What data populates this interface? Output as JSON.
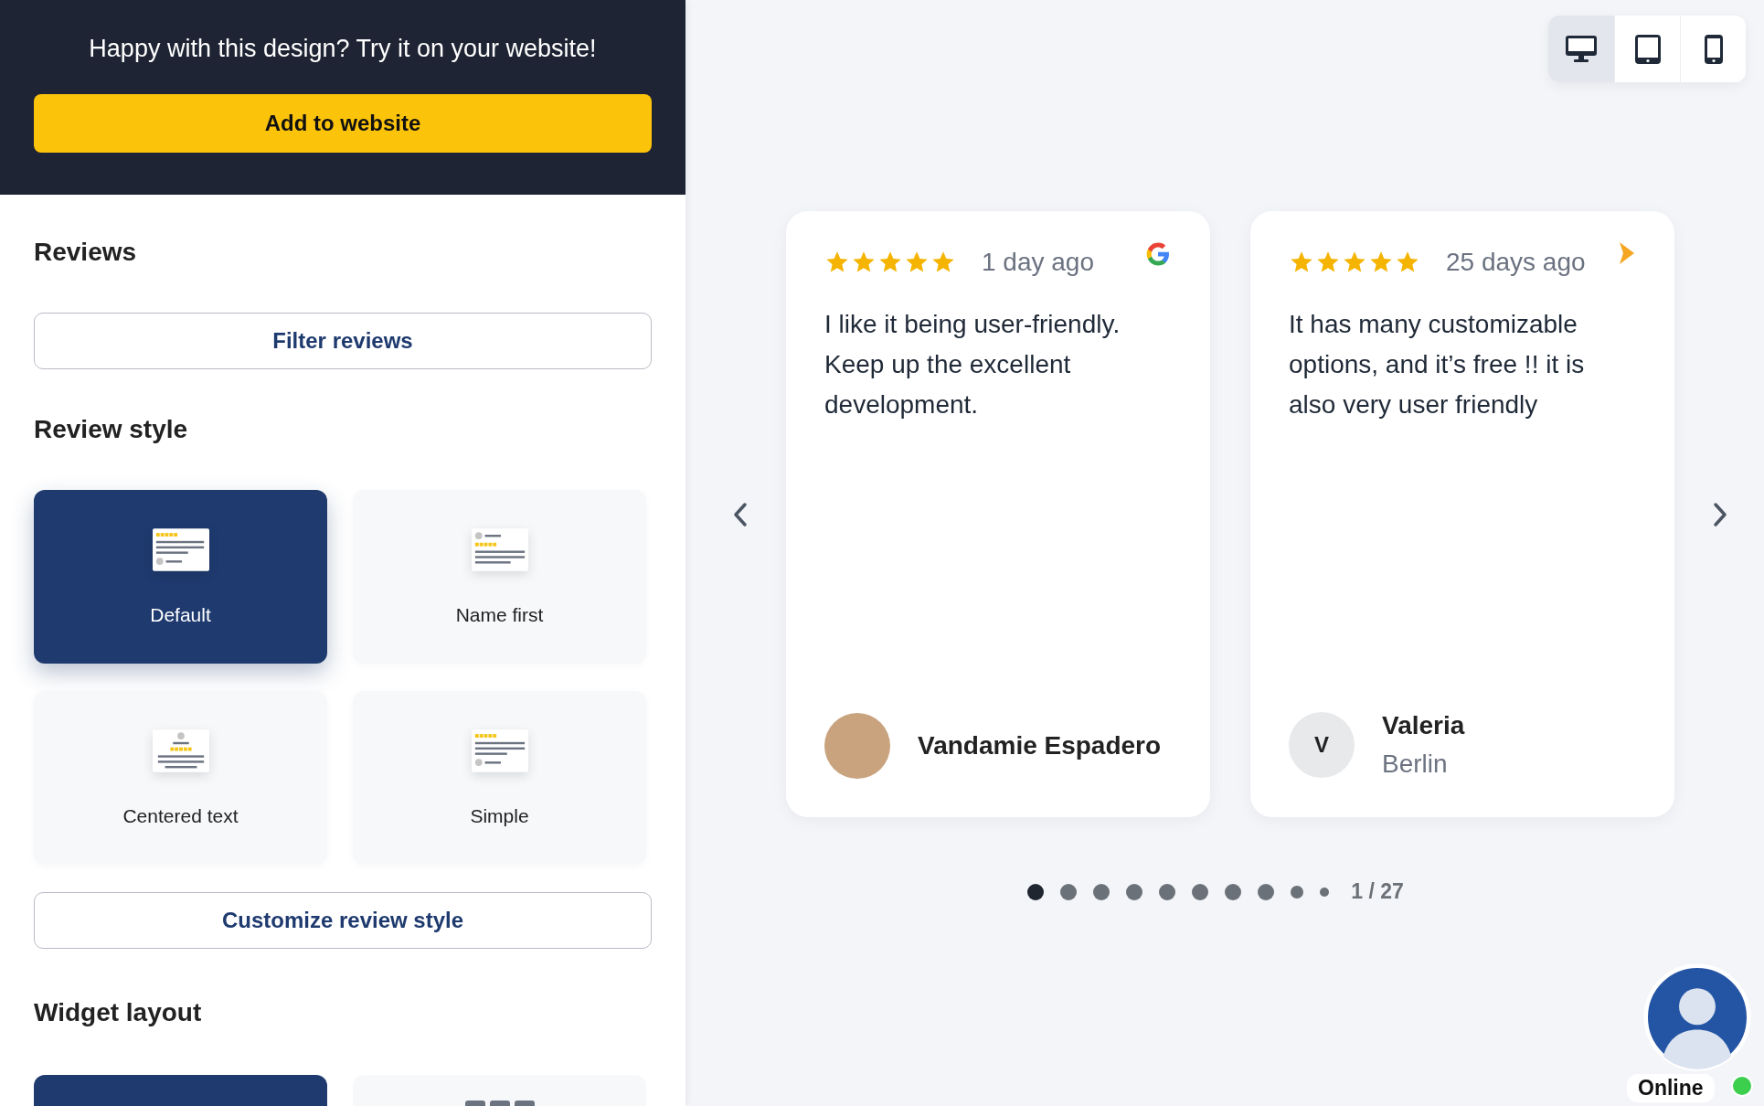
{
  "promo": {
    "text": "Happy with this design? Try it on your website!",
    "button": "Add to website"
  },
  "reviews_section": {
    "title": "Reviews",
    "filter_button": "Filter reviews"
  },
  "review_style": {
    "title": "Review style",
    "customize_button": "Customize review style",
    "options": [
      {
        "label": "Default",
        "kind": "default",
        "selected": true
      },
      {
        "label": "Name first",
        "kind": "name_first",
        "selected": false
      },
      {
        "label": "Centered text",
        "kind": "centered",
        "selected": false
      },
      {
        "label": "Simple",
        "kind": "simple",
        "selected": false
      }
    ]
  },
  "widget_layout": {
    "title": "Widget layout",
    "options": [
      {
        "kind": "slider",
        "selected": true
      },
      {
        "kind": "grid",
        "selected": false
      }
    ]
  },
  "device_toggle": [
    {
      "kind": "desktop",
      "selected": true
    },
    {
      "kind": "tablet",
      "selected": false
    },
    {
      "kind": "phone",
      "selected": false
    }
  ],
  "reviews": [
    {
      "stars": 5,
      "time": "1 day ago",
      "kind": "google",
      "text": "I like it being user-friendly. Keep up the excellent development.",
      "author": "Vandamie Espadero"
    },
    {
      "stars": 5,
      "time": "25 days ago",
      "kind": "arrow",
      "text": "It has many customizable options, and it’s free !! it is also very user friendly",
      "author": "Valeria",
      "location": "Berlin",
      "initial": "V"
    }
  ],
  "pagination": {
    "counter": "1 / 27",
    "dots": [
      {
        "selected": true,
        "kind": "full"
      },
      {
        "selected": false,
        "kind": "full"
      },
      {
        "selected": false,
        "kind": "full"
      },
      {
        "selected": false,
        "kind": "full"
      },
      {
        "selected": false,
        "kind": "full"
      },
      {
        "selected": false,
        "kind": "full"
      },
      {
        "selected": false,
        "kind": "full"
      },
      {
        "selected": false,
        "kind": "full"
      },
      {
        "selected": false,
        "kind": "small"
      },
      {
        "selected": false,
        "kind": "tiny"
      }
    ]
  },
  "chat": {
    "status": "Online",
    "online": true
  }
}
